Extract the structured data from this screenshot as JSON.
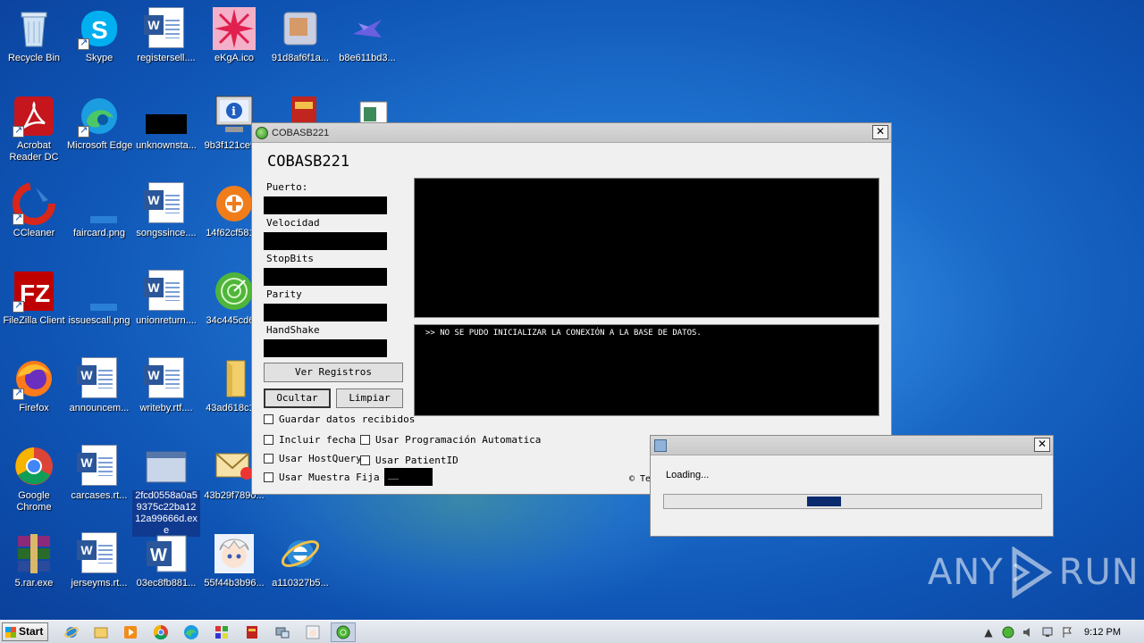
{
  "desktop": {
    "icons": [
      {
        "label": "Recycle Bin"
      },
      {
        "label": "Skype"
      },
      {
        "label": "registersell...."
      },
      {
        "label": "eKgA.ico"
      },
      {
        "label": "91d8af6f1a..."
      },
      {
        "label": "b8e611bd3..."
      },
      {
        "label": "Acrobat Reader DC"
      },
      {
        "label": "Microsoft Edge"
      },
      {
        "label": "unknownsta..."
      },
      {
        "label": "9b3f121ce9..."
      },
      {
        "label": "CCleaner"
      },
      {
        "label": "faircard.png"
      },
      {
        "label": "songssince...."
      },
      {
        "label": "14f62cf581..."
      },
      {
        "label": "FileZilla Client"
      },
      {
        "label": "issuescall.png"
      },
      {
        "label": "unionreturn...."
      },
      {
        "label": "34c445cd6..."
      },
      {
        "label": "Firefox"
      },
      {
        "label": "announcem..."
      },
      {
        "label": "writeby.rtf...."
      },
      {
        "label": "43ad618c1..."
      },
      {
        "label": "Google Chrome"
      },
      {
        "label": "carcases.rt..."
      },
      {
        "label": "2fcd0558a0a59375c22ba1212a99666d.exe"
      },
      {
        "label": "43b29f7890..."
      },
      {
        "label": "5.rar.exe"
      },
      {
        "label": "jerseyms.rt..."
      },
      {
        "label": "03ec8fb881..."
      },
      {
        "label": "55f44b3b96..."
      },
      {
        "label": "a110327b5..."
      }
    ]
  },
  "app": {
    "window_title": "COBASB221",
    "heading": "COBASB221",
    "fields": {
      "puerto": "Puerto:",
      "velocidad": "Velocidad",
      "stopbits": "StopBits",
      "parity": "Parity",
      "handshake": "HandShake"
    },
    "buttons": {
      "ver_registros": "Ver Registros",
      "ocultar": "Ocultar",
      "limpiar": "Limpiar"
    },
    "checkboxes": {
      "guardar": "Guardar datos recibidos",
      "incluir_fecha": "Incluir fecha",
      "programacion": "Usar Programación Automatica",
      "hostquery": "Usar HostQuery",
      "patientid": "Usar PatientID",
      "muestra_fija": "Usar Muestra Fija"
    },
    "sample_value": "__",
    "log_message": ">> NO SE PUDO INICIALIZAR LA CONEXIÓN A LA BASE DE DATOS.",
    "footer": "© Te"
  },
  "loading": {
    "message": "Loading...",
    "progress_fraction": 0.09
  },
  "watermark": {
    "left": "ANY",
    "right": "RUN"
  },
  "taskbar": {
    "start_label": "Start",
    "clock": "9:12 PM"
  },
  "colors": {
    "terminal_bg": "#000000",
    "progress_fill": "#0a2a6e",
    "desktop_bg": "#1d6fcd"
  }
}
